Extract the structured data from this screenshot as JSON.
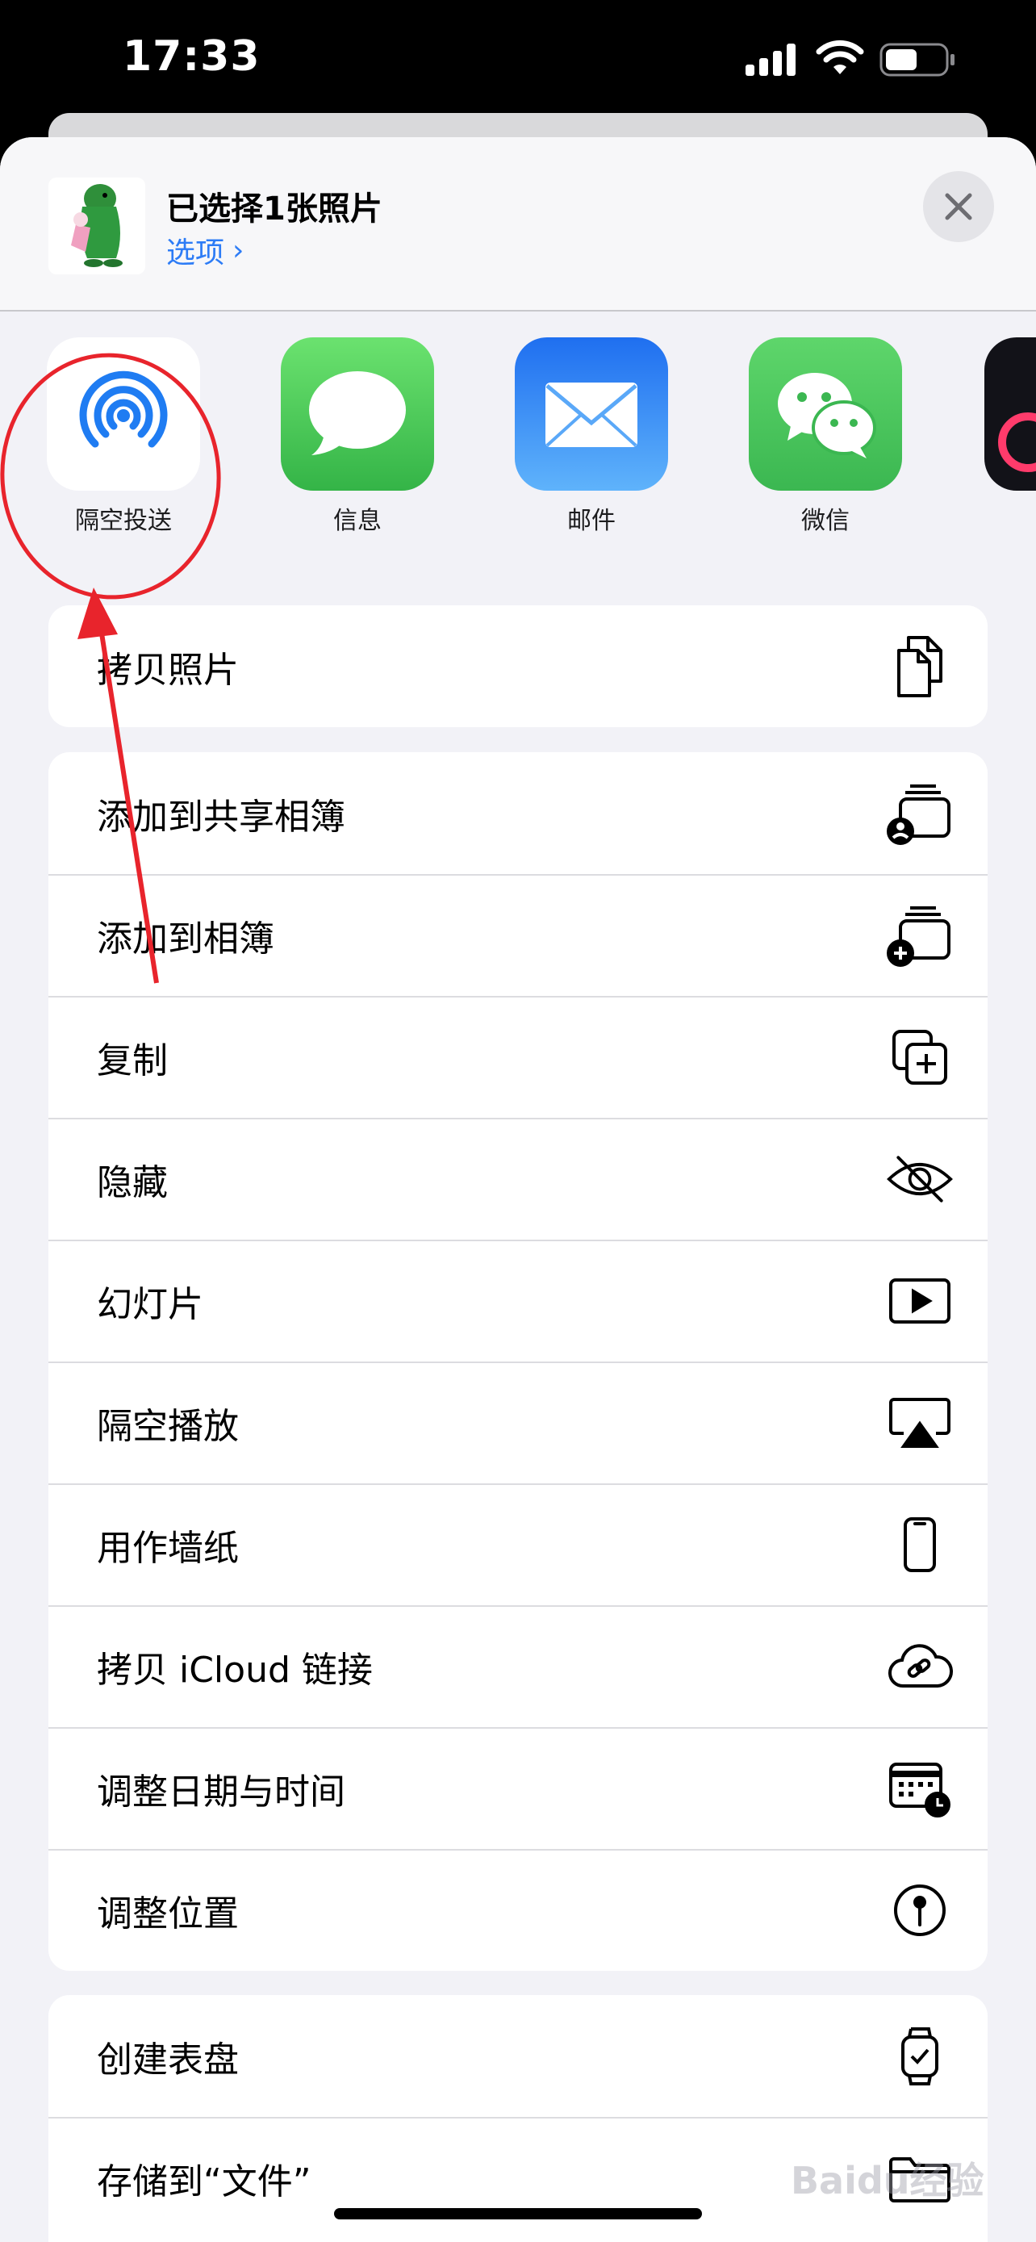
{
  "status_bar": {
    "time": "17:33"
  },
  "share_sheet": {
    "title": "已选择1张照片",
    "options_label": "选项",
    "options_chevron": "›"
  },
  "apps": [
    {
      "label": "隔空投送",
      "icon": "airdrop-icon",
      "color": "#ffffff"
    },
    {
      "label": "信息",
      "icon": "messages-icon",
      "color": "#4fd35c"
    },
    {
      "label": "邮件",
      "icon": "mail-icon",
      "color": "#2f8cf6"
    },
    {
      "label": "微信",
      "icon": "wechat-icon",
      "color": "#45c25b"
    },
    {
      "label": "",
      "icon": "partial-app-icon",
      "color": "#121218"
    }
  ],
  "actions_group_1": [
    {
      "label": "拷贝照片",
      "icon": "copy-photo-icon"
    }
  ],
  "actions_group_2": [
    {
      "label": "添加到共享相簿",
      "icon": "shared-album-icon"
    },
    {
      "label": "添加到相簿",
      "icon": "add-album-icon"
    },
    {
      "label": "复制",
      "icon": "duplicate-icon"
    },
    {
      "label": "隐藏",
      "icon": "hide-eye-icon"
    },
    {
      "label": "幻灯片",
      "icon": "slideshow-icon"
    },
    {
      "label": "隔空播放",
      "icon": "airplay-icon"
    },
    {
      "label": "用作墙纸",
      "icon": "wallpaper-phone-icon"
    },
    {
      "label": "拷贝 iCloud 链接",
      "icon": "icloud-link-icon"
    },
    {
      "label": "调整日期与时间",
      "icon": "calendar-clock-icon"
    },
    {
      "label": "调整位置",
      "icon": "location-pin-icon"
    }
  ],
  "actions_group_3": [
    {
      "label": "创建表盘",
      "icon": "watch-face-icon"
    },
    {
      "label": "存储到“文件”",
      "icon": "folder-icon"
    }
  ],
  "watermark": "Baidu经验",
  "colors": {
    "accent": "#2d7cf6",
    "annotation": "#e8242c"
  }
}
